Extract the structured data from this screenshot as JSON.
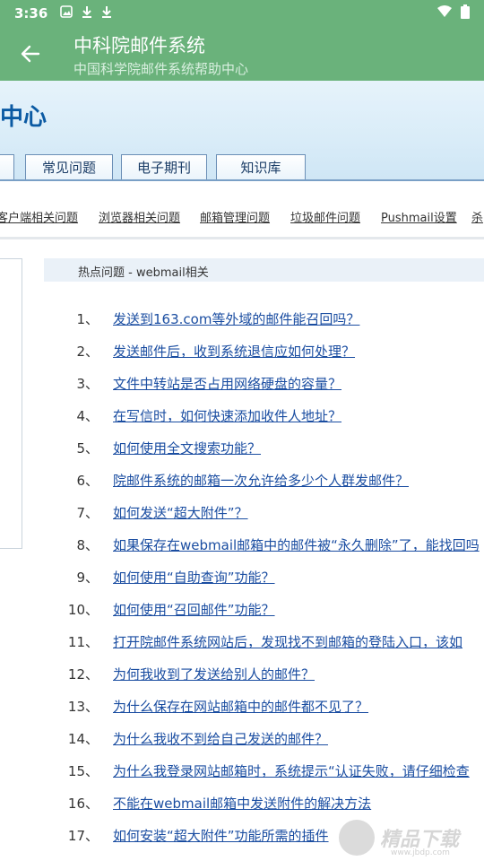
{
  "status": {
    "time": "3:36"
  },
  "appbar": {
    "title": "中科院邮件系统",
    "subtitle": "中国科学院邮件系统帮助中心"
  },
  "hero": {
    "brand": "中心"
  },
  "tabs": [
    "常见问题",
    "电子期刊",
    "知识库"
  ],
  "subnav": [
    "客户端相关问题",
    "浏览器相关问题",
    "邮箱管理问题",
    "垃圾邮件问题",
    "Pushmail设置",
    "杀"
  ],
  "section": {
    "title": "热点问题 - webmail相关"
  },
  "faq": [
    {
      "num": "1、",
      "text": "发送到163.com等外域的邮件能召回吗？"
    },
    {
      "num": "2、",
      "text": "发送邮件后，收到系统退信应如何处理？"
    },
    {
      "num": "3、",
      "text": "文件中转站是否占用网络硬盘的容量？"
    },
    {
      "num": "4、",
      "text": "在写信时，如何快速添加收件人地址？"
    },
    {
      "num": "5、",
      "text": "如何使用全文搜索功能？"
    },
    {
      "num": "6、",
      "text": "院邮件系统的邮箱一次允许给多少个人群发邮件？"
    },
    {
      "num": "7、",
      "text": "如何发送“超大附件”？"
    },
    {
      "num": "8、",
      "text": "如果保存在webmail邮箱中的邮件被“永久删除”了，能找回吗"
    },
    {
      "num": "9、",
      "text": "如何使用“自助查询”功能？"
    },
    {
      "num": "10、",
      "text": "如何使用“召回邮件”功能？"
    },
    {
      "num": "11、",
      "text": "打开院邮件系统网站后，发现找不到邮箱的登陆入口，该如"
    },
    {
      "num": "12、",
      "text": "为何我收到了发送给别人的邮件？"
    },
    {
      "num": "13、",
      "text": "为什么保存在网站邮箱中的邮件都不见了？"
    },
    {
      "num": "14、",
      "text": "为什么我收不到给自己发送的邮件？"
    },
    {
      "num": "15、",
      "text": "为什么我登录网站邮箱时，系统提示“认证失败，请仔细检查"
    },
    {
      "num": "16、",
      "text": "不能在webmail邮箱中发送附件的解决方法"
    },
    {
      "num": "17、",
      "text": "如何安装“超大附件”功能所需的插件"
    }
  ],
  "watermark": {
    "text": "精品下载",
    "url": "www.jbdp.com"
  },
  "colors": {
    "appbar": "#6ab27b",
    "link": "#1a4da1",
    "brand": "#0b5aa3"
  }
}
